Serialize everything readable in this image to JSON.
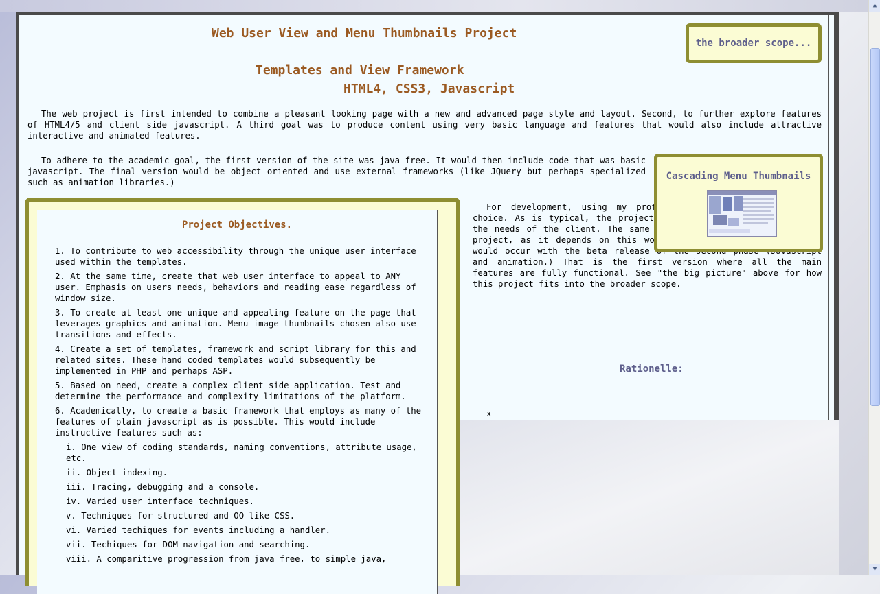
{
  "header": {
    "title": "Web User View and Menu Thumbnails Project",
    "subtitle_1": "Templates and View Framework",
    "subtitle_2": "HTML4, CSS3, Javascript"
  },
  "intro": {
    "para1": "The web project is first intended to combine a pleasant looking page with a new and advanced page style and layout. Second, to further explore features of HTML4/5 and client side javascript. A third goal was to produce content using very basic language and features that would also include attractive interactive and animated features.",
    "para2": "To adhere to the academic goal, the first version of the site was java free. It would then include code that was basic javascript. The final version would be object oriented and use external frameworks (like JQuery but perhaps specialized such as animation libraries.)",
    "para3": "For development, using my professional page was the logical choice. As is typical, the project start date was chosen based on the needs of the client. The same holds true for starting the PHP project, as it depends on this work. Actually releasing the site would occur with the beta release of the second phase (Javascript and animation.) That is the first version where all the main features are fully functional. See \"the big picture\" above for how this project fits into the broader scope."
  },
  "scope_link": "the broader scope...",
  "thumbnail": {
    "title": "Cascading Menu Thumbnails"
  },
  "objectives": {
    "title": "Project Objectives.",
    "items": [
      "1. To contribute to web accessibility through the unique user interface used within the templates.",
      "2. At the same time, create that web user interface to appeal to ANY user. Emphasis on users needs, behaviors and reading ease regardless of window size.",
      "3. To create at least one unique and appealing feature on the page that leverages graphics and animation. Menu image thumbnails chosen also use transitions and effects.",
      "4. Create a set of templates, framework and script library for this and related sites. These hand coded templates would subsequently be implemented in PHP and perhaps ASP.",
      "5. Based on need, create a complex client side application. Test and determine the performance and complexity limitations of the platform.",
      "6. Academically, to create a basic framework that employs as many of the features of plain javascript as is possible. This would include instructive features such as:"
    ],
    "subitems": [
      "i. One view of coding standards, naming conventions, attribute usage, etc.",
      "ii. Object indexing.",
      "iii. Tracing, debugging and a console.",
      "iv. Varied user interface techniques.",
      "v. Techniques for structured and OO-like CSS.",
      "vi. Varied techiques for events including a handler.",
      "vii. Techiques for DOM navigation and searching.",
      "viii. A comparitive progression from java free, to simple java,"
    ]
  },
  "rationale": {
    "title": "Rationelle:",
    "text": "x"
  },
  "scrollbar": {
    "up": "▲",
    "down": "▼"
  }
}
